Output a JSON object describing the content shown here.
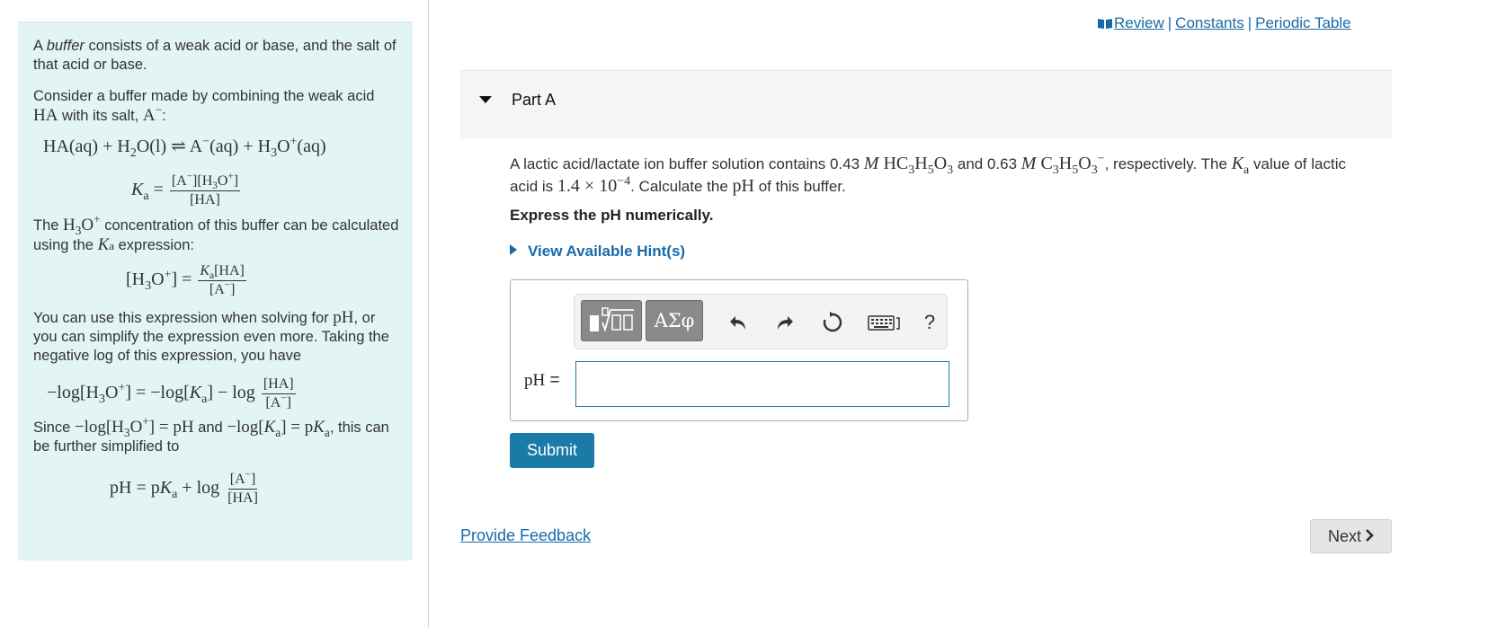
{
  "intro": {
    "p1_a": "A ",
    "p1_em": "buffer",
    "p1_b": " consists of a weak acid or base, and the salt of that acid or base.",
    "p2_a": "Consider a buffer made by combining the weak acid ",
    "p2_b": " with its salt, ",
    "p3_a": "The ",
    "p3_b": " concentration of this buffer can be calculated using the ",
    "p3_c": " expression:",
    "p4_a": "You can use this expression when solving for ",
    "p4_b": ", or you can simplify the expression even more. Taking the negative log of this expression, you have",
    "p5_a": "Since ",
    "p5_b": " and ",
    "p5_c": ", this can be further simplified to"
  },
  "toplinks": {
    "review": "Review",
    "constants": "Constants",
    "periodic_table": "Periodic Table",
    "separator": "|"
  },
  "part": {
    "title": "Part A"
  },
  "question": {
    "t1": "A lactic acid/lactate ion buffer solution contains 0.43 ",
    "t2": " and 0.63 ",
    "t3": ", respectively. The ",
    "t4": " value of lactic acid is ",
    "t5": ". Calculate the ",
    "t6": " of this buffer."
  },
  "instruction": "Express the pH numerically.",
  "hint_label": "View Available Hint(s)",
  "toolbar": {
    "symbols_label": "ΑΣφ",
    "help_label": "?"
  },
  "answer": {
    "label": "pH",
    "equals": "=",
    "value": ""
  },
  "submit_label": "Submit",
  "feedback_label": "Provide Feedback",
  "next_label": "Next",
  "colors": {
    "intro_bg": "#e3f4f4",
    "link": "#1a6aa8",
    "submit_bg": "#1a7ba6",
    "input_border": "#1a7fa8",
    "next_bg": "#e5e5e5"
  }
}
